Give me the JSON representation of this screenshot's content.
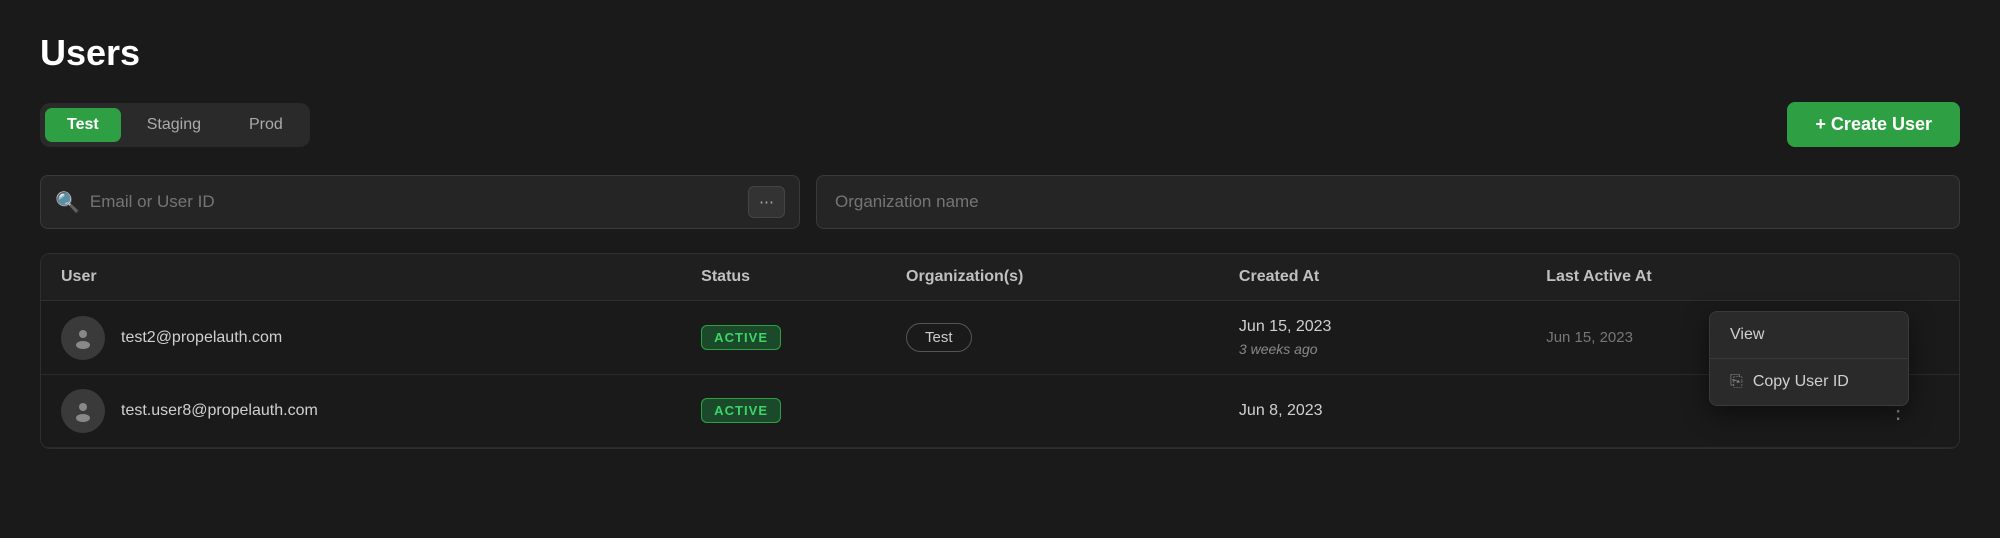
{
  "page": {
    "title": "Users"
  },
  "env_tabs": {
    "tabs": [
      {
        "id": "test",
        "label": "Test",
        "active": true
      },
      {
        "id": "staging",
        "label": "Staging",
        "active": false
      },
      {
        "id": "prod",
        "label": "Prod",
        "active": false
      }
    ]
  },
  "create_user_button": {
    "label": "+ Create User"
  },
  "search": {
    "email_placeholder": "Email or User ID",
    "org_placeholder": "Organization name"
  },
  "table": {
    "headers": {
      "user": "User",
      "status": "Status",
      "organizations": "Organization(s)",
      "created_at": "Created At",
      "last_active_at": "Last Active At"
    },
    "rows": [
      {
        "email": "test2@propelauth.com",
        "status": "ACTIVE",
        "org": "Test",
        "created_date": "Jun 15, 2023",
        "created_relative": "3 weeks ago",
        "last_active": "Jun 15, 2023",
        "show_menu": true
      },
      {
        "email": "test.user8@propelauth.com",
        "status": "ACTIVE",
        "org": "",
        "created_date": "Jun 8, 2023",
        "created_relative": "",
        "last_active": "",
        "show_menu": false
      }
    ]
  },
  "context_menu": {
    "items": [
      {
        "id": "view",
        "label": "View",
        "icon": ""
      },
      {
        "id": "copy-user-id",
        "label": "Copy User ID",
        "icon": "copy"
      }
    ]
  },
  "icons": {
    "search": "🔍",
    "three_dots": "⋮",
    "filter": "⠿",
    "copy": "⧉",
    "user_avatar": "👤"
  }
}
